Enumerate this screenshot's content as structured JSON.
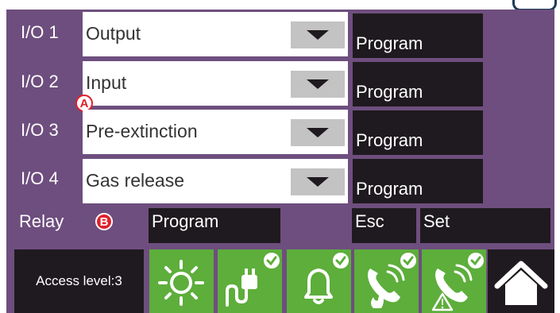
{
  "io_rows": [
    {
      "label": "I/O 1",
      "value": "Output",
      "program_label": "Program"
    },
    {
      "label": "I/O 2",
      "value": "Input",
      "program_label": "Program"
    },
    {
      "label": "I/O 3",
      "value": "Pre-extinction",
      "program_label": "Program"
    },
    {
      "label": "I/O 4",
      "value": "Gas release",
      "program_label": "Program"
    }
  ],
  "markers": {
    "a": "A",
    "b": "B"
  },
  "relay": {
    "label": "Relay",
    "program_label": "Program"
  },
  "actions": {
    "esc_label": "Esc",
    "set_label": "Set"
  },
  "status_bar": {
    "access_level": "Access level:3",
    "icons": [
      "sun-icon",
      "power-plug-check-icon",
      "bell-check-icon",
      "phone-fire-check-icon",
      "phone-warning-check-icon",
      "home-icon"
    ]
  },
  "colors": {
    "panel": "#6e4e7e",
    "dark_button": "#1f1a1f",
    "status_tile_green": "#5dae3b",
    "marker_red": "#e0202a",
    "dropdown_button": "#c3c3c3"
  }
}
